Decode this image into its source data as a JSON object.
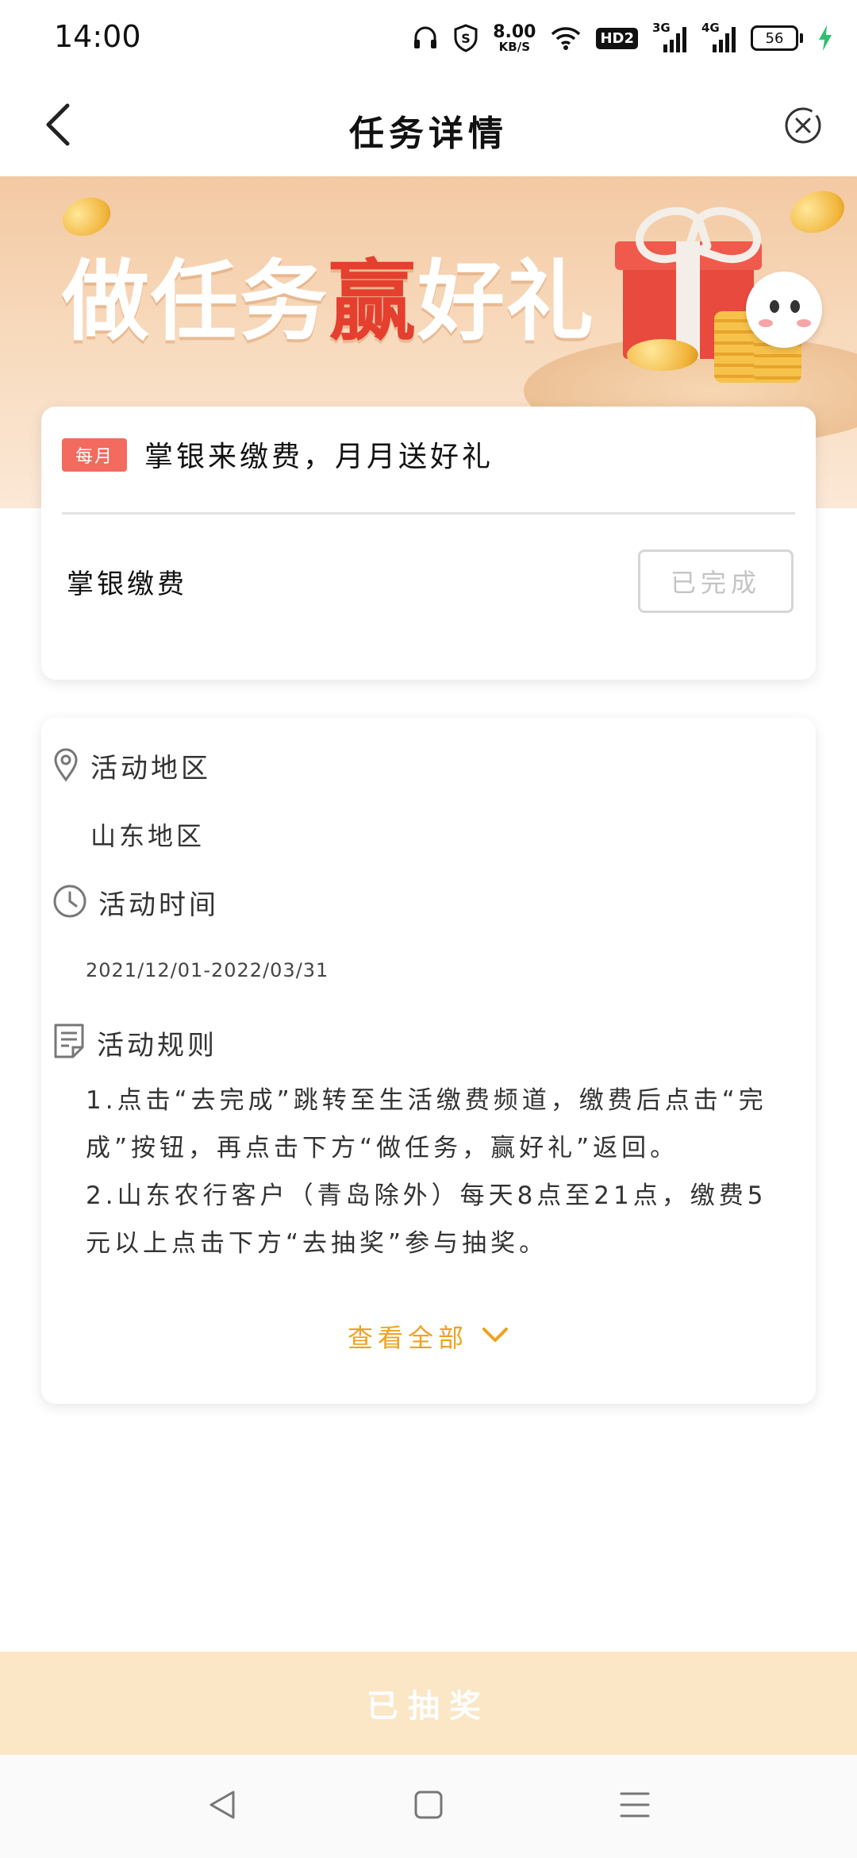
{
  "status_bar": {
    "time": "14:00",
    "net_speed_value": "8.00",
    "net_speed_unit": "KB/S",
    "hd_badge": "HD2",
    "sim1_label": "3G",
    "sim2_label": "4G",
    "battery_level": "56",
    "icons": [
      "headphones-icon",
      "shield-icon",
      "wifi-icon",
      "hd-icon",
      "signal-icon",
      "battery-icon",
      "charging-icon"
    ]
  },
  "header": {
    "title": "任务详情",
    "back_icon": "chevron-left-icon",
    "close_icon": "close-circle-icon"
  },
  "banner": {
    "text_before": "做任务",
    "text_highlight": "赢",
    "text_after": "好礼",
    "highlight_color": "#e53f2f"
  },
  "task": {
    "frequency_badge": "每月",
    "title": "掌银来缴费，月月送好礼",
    "name": "掌银缴费",
    "status_button": "已完成"
  },
  "info": {
    "region_label": "活动地区",
    "region_value": "山东地区",
    "time_label": "活动时间",
    "time_value": "2021/12/01-2022/03/31",
    "rules_label": "活动规则",
    "rule_1": "1.点击“去完成”跳转至生活缴费频道，缴费后点击“完成”按钮，再点击下方“做任务，赢好礼”返回。",
    "rule_2": "2.山东农行客户（青岛除外）每天8点至21点，缴费5元以上点击下方“去抽奖”参与抽奖。",
    "view_all": "查看全部"
  },
  "bottom_action": {
    "label": "已抽奖",
    "bg_color": "#fbe6c6"
  },
  "nav_bar": {
    "buttons": [
      "back-triangle-icon",
      "home-square-icon",
      "menu-lines-icon"
    ]
  },
  "colors": {
    "accent_orange": "#f0a11f",
    "badge_red": "#f36a5e"
  }
}
